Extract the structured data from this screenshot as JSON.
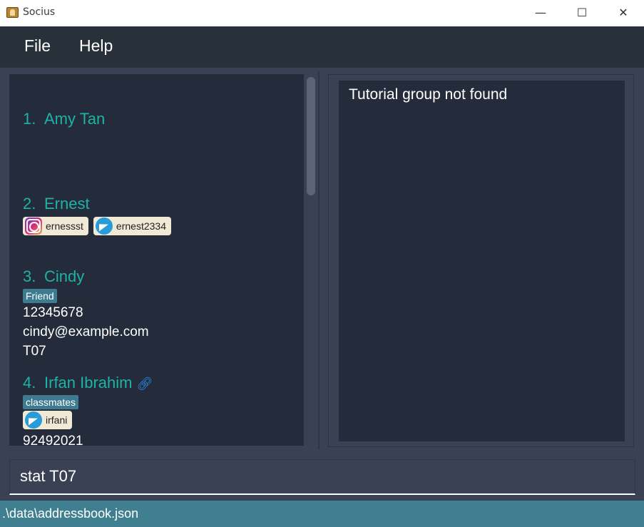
{
  "window": {
    "title": "Socius",
    "minimize": "—",
    "maximize": "☐",
    "close": "✕"
  },
  "menu": {
    "items": [
      {
        "label": "File"
      },
      {
        "label": "Help"
      }
    ]
  },
  "persons": [
    {
      "index": "1.",
      "name": "Amy Tan"
    },
    {
      "index": "2.",
      "name": "Ernest",
      "socials": [
        {
          "icon": "instagram-icon",
          "handle": "ernessst"
        },
        {
          "icon": "telegram-icon",
          "handle": "ernest2334"
        }
      ]
    },
    {
      "index": "3.",
      "name": "Cindy",
      "tag": "Friend",
      "phone": "12345678",
      "email": "cindy@example.com",
      "group": "T07"
    },
    {
      "index": "4.",
      "name": "Irfan Ibrahim",
      "link_icon": "link-icon",
      "tag": "classmates",
      "socials": [
        {
          "icon": "telegram-icon",
          "handle": "irfani"
        }
      ],
      "phone": "92492021"
    }
  ],
  "result": {
    "message": "Tutorial group not found"
  },
  "command": {
    "value": "stat T07"
  },
  "status": {
    "path": ".\\data\\addressbook.json"
  },
  "colors": {
    "name": "#1fb2a6",
    "tag": "#3e7b91",
    "status_bar": "#3f7f90",
    "panel": "#242b3b"
  }
}
